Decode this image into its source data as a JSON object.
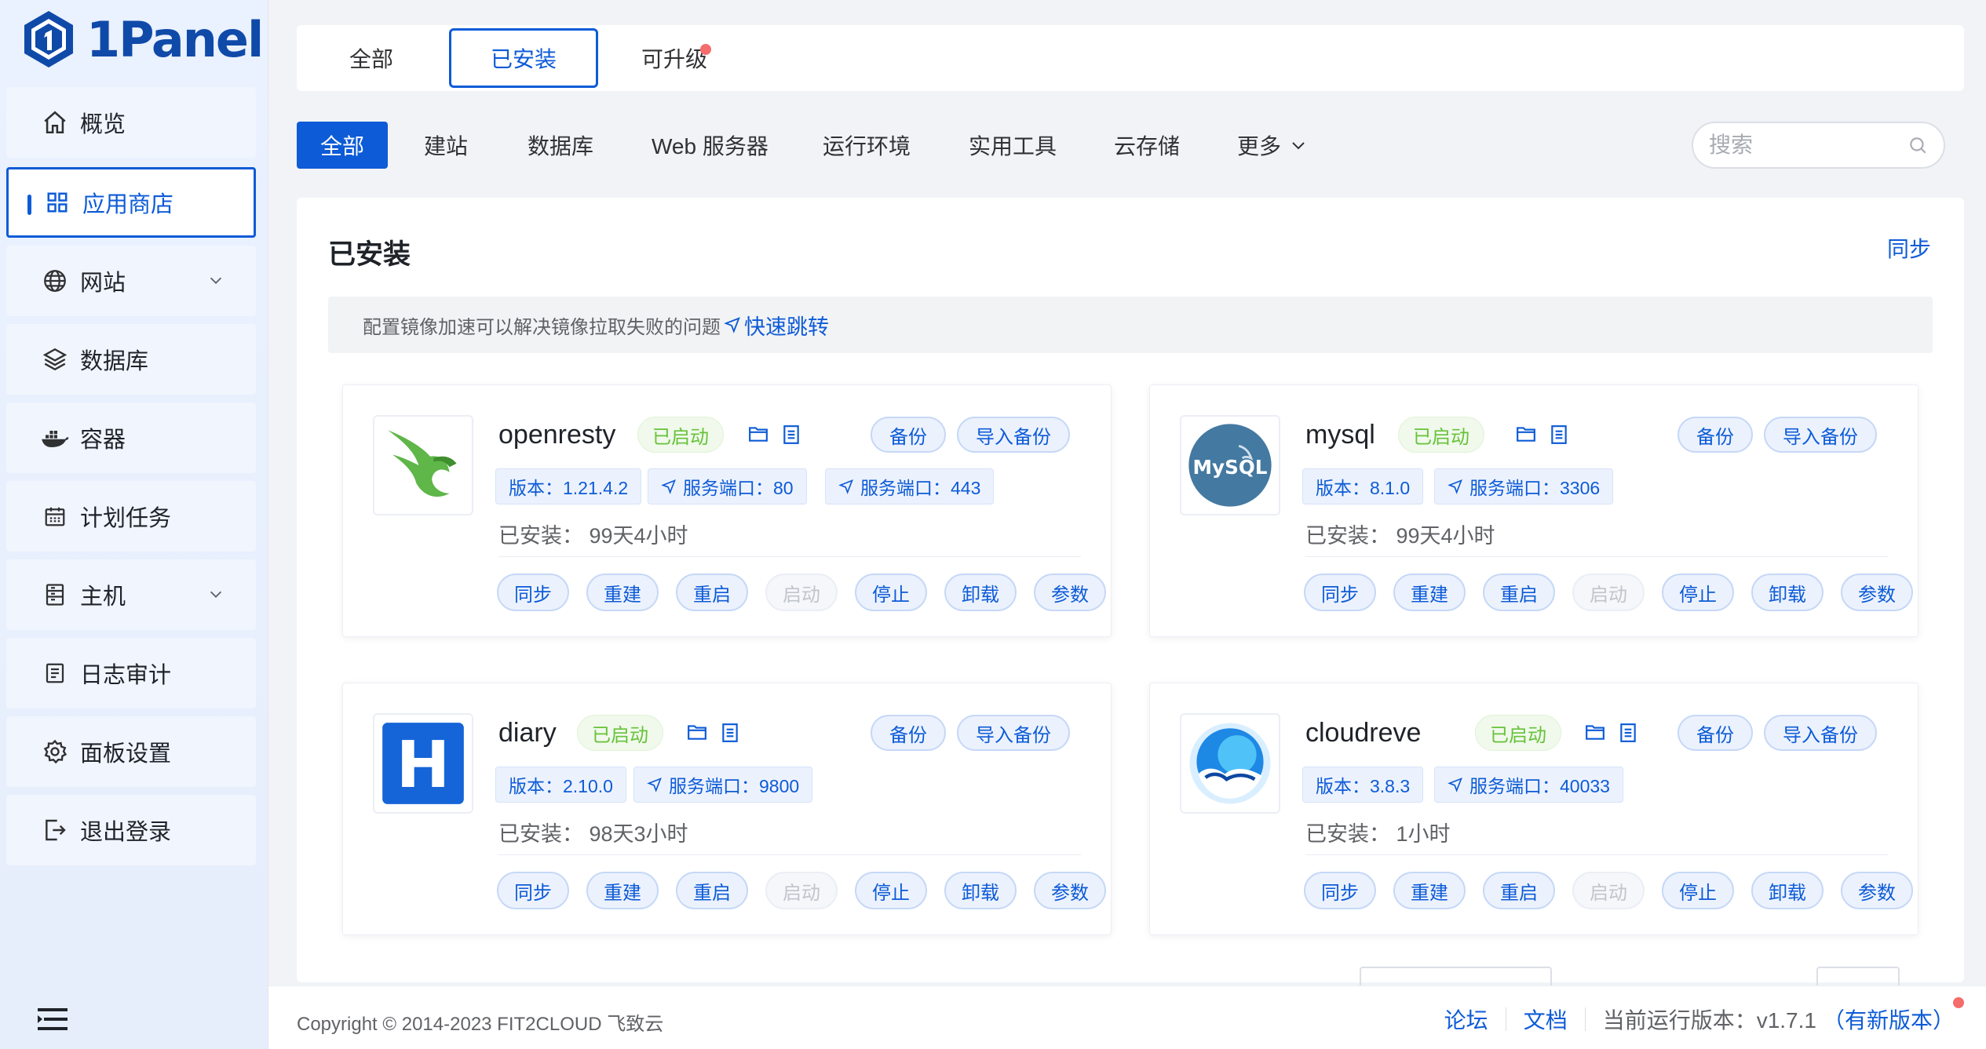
{
  "brand": {
    "name": "1Panel"
  },
  "sidebar": {
    "items": [
      {
        "label": "概览"
      },
      {
        "label": "应用商店"
      },
      {
        "label": "网站"
      },
      {
        "label": "数据库"
      },
      {
        "label": "容器"
      },
      {
        "label": "计划任务"
      },
      {
        "label": "主机"
      },
      {
        "label": "日志审计"
      },
      {
        "label": "面板设置"
      },
      {
        "label": "退出登录"
      }
    ]
  },
  "top_tabs": [
    {
      "label": "全部"
    },
    {
      "label": "已安装"
    },
    {
      "label": "可升级"
    }
  ],
  "categories": [
    {
      "label": "全部"
    },
    {
      "label": "建站"
    },
    {
      "label": "数据库"
    },
    {
      "label": "Web 服务器"
    },
    {
      "label": "运行环境"
    },
    {
      "label": "实用工具"
    },
    {
      "label": "云存储"
    },
    {
      "label": "更多"
    }
  ],
  "search": {
    "placeholder": "搜索"
  },
  "panel": {
    "title": "已安装",
    "sync_label": "同步",
    "notice_text": "配置镜像加速可以解决镜像拉取失败的问题",
    "notice_link": "快速跳转"
  },
  "common": {
    "backup": "备份",
    "import_backup": "导入备份",
    "actions": [
      "同步",
      "重建",
      "重启",
      "启动",
      "停止",
      "卸载",
      "参数"
    ]
  },
  "apps": [
    {
      "name": "openresty",
      "status": "已启动",
      "version": "版本：1.21.4.2",
      "ports": [
        "服务端口：80",
        "服务端口：443"
      ],
      "installed": "已安装： 99天4小时"
    },
    {
      "name": "mysql",
      "status": "已启动",
      "version": "版本：8.1.0",
      "ports": [
        "服务端口：3306"
      ],
      "installed": "已安装： 99天4小时",
      "logo_text": "MySQL"
    },
    {
      "name": "diary",
      "status": "已启动",
      "version": "版本：2.10.0",
      "ports": [
        "服务端口：9800"
      ],
      "installed": "已安装： 98天3小时",
      "logo_text": "H"
    },
    {
      "name": "cloudreve",
      "status": "已启动",
      "version": "版本：3.8.3",
      "ports": [
        "服务端口：40033"
      ],
      "installed": "已安装： 1小时"
    }
  ],
  "footer": {
    "copyright": "Copyright © 2014-2023 FIT2CLOUD 飞致云",
    "forum": "论坛",
    "docs": "文档",
    "version_text": "当前运行版本：v1.7.1",
    "new_version": "（有新版本）"
  },
  "colors": {
    "primary": "#0d5bd7",
    "success": "#67c23a",
    "badge": "#f56c6c"
  }
}
